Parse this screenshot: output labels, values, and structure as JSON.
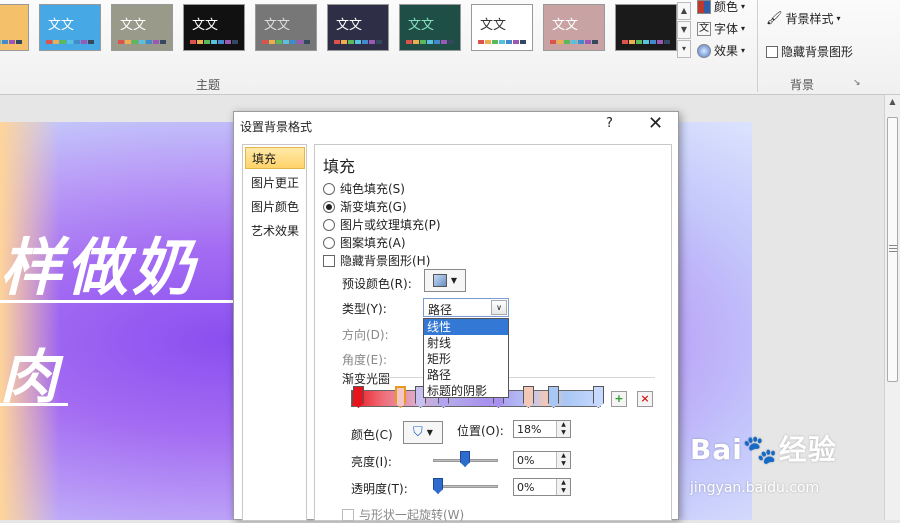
{
  "ribbon": {
    "theme_thumbs": [
      {
        "label": "",
        "bg": "#f4c06a",
        "fg": "#333333"
      },
      {
        "label": "文文",
        "bg": "#47a8e6",
        "fg": "#ffffff"
      },
      {
        "label": "文文",
        "bg": "#9a9a8a",
        "fg": "#ffffff"
      },
      {
        "label": "文文",
        "bg": "#111111",
        "fg": "#ffffff"
      },
      {
        "label": "文文",
        "bg": "#777777",
        "fg": "#dddddd"
      },
      {
        "label": "文文",
        "bg": "#2e2e46",
        "fg": "#ffffff"
      },
      {
        "label": "文文",
        "bg": "#1e4e46",
        "fg": "#88e0c0"
      },
      {
        "label": "文文",
        "bg": "#ffffff",
        "fg": "#333333"
      },
      {
        "label": "文文",
        "bg": "#c9a3a3",
        "fg": "#ffffff"
      },
      {
        "label": "",
        "bg": "#1a1a1a",
        "fg": "#ffffff"
      }
    ],
    "colors_label": "颜色",
    "fonts_label": "字体",
    "effects_label": "效果",
    "bg_style_label": "背景样式",
    "hide_bg_label": "隐藏背景图形",
    "theme_group_label": "主题",
    "bg_group_label": "背景"
  },
  "slide": {
    "title": "样做奶",
    "subtitle": "肉"
  },
  "dialog": {
    "title": "设置背景格式",
    "help": "?",
    "close": "✕",
    "nav": [
      "填充",
      "图片更正",
      "图片颜色",
      "艺术效果"
    ],
    "fill_heading": "填充",
    "options": {
      "solid": "纯色填充(S)",
      "gradient": "渐变填充(G)",
      "picture": "图片或纹理填充(P)",
      "pattern": "图案填充(A)",
      "hide_bg": "隐藏背景图形(H)"
    },
    "preset_label": "预设颜色(R):",
    "type_label": "类型(Y):",
    "type_value": "路径",
    "type_options": [
      "线性",
      "射线",
      "矩形",
      "路径",
      "标题的阴影"
    ],
    "direction_label": "方向(D):",
    "angle_label": "角度(E):",
    "stops_label": "渐变光圈",
    "color_label": "颜色(C)",
    "position_label": "位置(O):",
    "position_value": "18%",
    "brightness_label": "亮度(I):",
    "brightness_value": "0%",
    "transparency_label": "透明度(T):",
    "transparency_value": "0%",
    "rotate_label": "与形状一起旋转(W)"
  },
  "watermark": {
    "logo": "Bai🐾经验",
    "url": "jingyan.baidu.com"
  }
}
